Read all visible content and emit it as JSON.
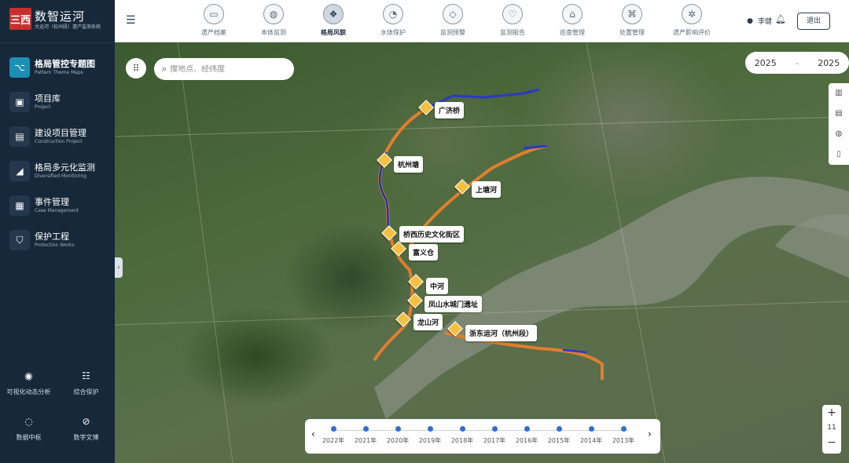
{
  "brand": {
    "logo": "三西",
    "title": "数智运河",
    "subtitle": "大运河（杭州段）遗产监测系统"
  },
  "nav": [
    {
      "cn": "格局管控专题图",
      "en": "Pattern Theme Maps",
      "icon": "⌥",
      "active": true
    },
    {
      "cn": "项目库",
      "en": "Project",
      "icon": "▣",
      "active": false
    },
    {
      "cn": "建设项目管理",
      "en": "Construction Project",
      "icon": "▤",
      "active": false
    },
    {
      "cn": "格局多元化监测",
      "en": "Diversified Monitoring",
      "icon": "◢",
      "active": false
    },
    {
      "cn": "事件管理",
      "en": "Case Management",
      "icon": "▦",
      "active": false
    },
    {
      "cn": "保护工程",
      "en": "Protection Works",
      "icon": "⛉",
      "active": false
    }
  ],
  "tools": [
    {
      "label": "可视化动态分析",
      "icon": "◉"
    },
    {
      "label": "综合保护",
      "icon": "☷"
    },
    {
      "label": "数据中枢",
      "icon": "◌"
    },
    {
      "label": "数字文博",
      "icon": "⊘"
    }
  ],
  "topnav": [
    {
      "label": "遗产档案",
      "icon": "▭",
      "active": false
    },
    {
      "label": "本体监测",
      "icon": "◍",
      "active": false
    },
    {
      "label": "格局风貌",
      "icon": "❖",
      "active": true
    },
    {
      "label": "水体保护",
      "icon": "◔",
      "active": false
    },
    {
      "label": "监测预警",
      "icon": "◇",
      "active": false
    },
    {
      "label": "监测报告",
      "icon": "♡",
      "active": false
    },
    {
      "label": "巡查管理",
      "icon": "⌂",
      "active": false
    },
    {
      "label": "处置管理",
      "icon": "⌘",
      "active": false
    },
    {
      "label": "遗产影响评价",
      "icon": "✲",
      "active": false
    }
  ],
  "user": {
    "name": "李健",
    "logout": "退出"
  },
  "map": {
    "search_placeholder": "搜地点、经纬度",
    "year_from": "2025",
    "year_to": "2025",
    "zoom_level": "11",
    "sites": [
      "广济桥",
      "杭州塘",
      "上塘河",
      "桥西历史文化街区",
      "富义仓",
      "中河",
      "凤山水城门遗址",
      "龙山河",
      "浙东运河（杭州段）"
    ]
  },
  "timeline": [
    "2022年",
    "2021年",
    "2020年",
    "2019年",
    "2018年",
    "2017年",
    "2016年",
    "2015年",
    "2014年",
    "2013年"
  ]
}
